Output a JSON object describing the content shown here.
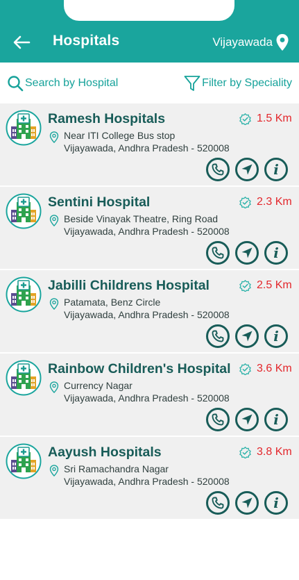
{
  "header": {
    "title": "Hospitals",
    "city": "Vijayawada"
  },
  "toolbar": {
    "search_label": "Search by Hospital",
    "filter_label": "Filter by Speciality"
  },
  "colors": {
    "primary": "#1aa59d",
    "text_dark": "#185c58",
    "distance": "#e3262b",
    "card_bg": "#f0f0f0"
  },
  "hospitals": [
    {
      "name": "Ramesh Hospitals",
      "distance": "1.5 Km",
      "address_line1": "Near ITI College Bus stop",
      "address_line2": "Vijayawada, Andhra Pradesh - 520008"
    },
    {
      "name": "Sentini Hospital",
      "distance": "2.3 Km",
      "address_line1": "Beside Vinayak Theatre, Ring Road",
      "address_line2": "Vijayawada, Andhra Pradesh - 520008"
    },
    {
      "name": "Jabilli Childrens Hospital",
      "distance": "2.5 Km",
      "address_line1": "Patamata, Benz Circle",
      "address_line2": "Vijayawada, Andhra Pradesh - 520008"
    },
    {
      "name": "Rainbow Children's Hospital",
      "distance": "3.6 Km",
      "address_line1": "Currency Nagar",
      "address_line2": "Vijayawada, Andhra Pradesh - 520008"
    },
    {
      "name": "Aayush Hospitals",
      "distance": "3.8 Km",
      "address_line1": "Sri Ramachandra Nagar",
      "address_line2": "Vijayawada, Andhra Pradesh - 520008"
    }
  ],
  "icons": [
    "back-arrow-icon",
    "location-pin-icon",
    "search-icon",
    "filter-icon",
    "hospital-icon",
    "verified-icon",
    "map-pin-icon",
    "phone-icon",
    "navigate-icon",
    "info-icon"
  ]
}
